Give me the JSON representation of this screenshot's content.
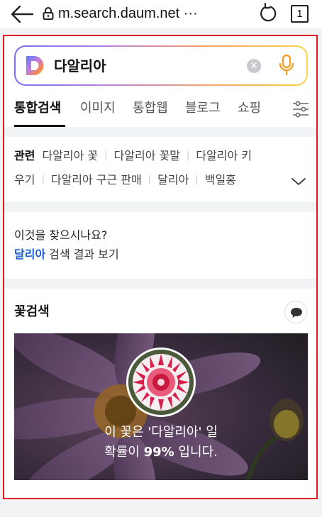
{
  "browser": {
    "url": "m.search.daum.net ···",
    "tab_count": "1"
  },
  "search": {
    "query": "다알리아",
    "tabs": [
      {
        "label": "통합검색"
      },
      {
        "label": "이미지"
      },
      {
        "label": "통합웹"
      },
      {
        "label": "블로그"
      },
      {
        "label": "쇼핑"
      }
    ]
  },
  "related": {
    "label": "관련",
    "line1": [
      "다알리아 꽃",
      "다알리아 꽃말",
      "다알리아 키"
    ],
    "line2": [
      "우기",
      "다알리아 구근 판매",
      "달리아",
      "백일홍"
    ]
  },
  "suggest": {
    "question": "이것을 찾으시나요?",
    "link": "달리아",
    "suffix": " 검색 결과 보기"
  },
  "flower": {
    "title": "꽃검색",
    "result_line1": "이 꽃은 '다알리아' 일",
    "result_prefix": "확률이 ",
    "result_percent": "99%",
    "result_suffix": " 입니다."
  },
  "colors": {
    "accent_frame": "#e21a1f",
    "link": "#1a5fd0",
    "search_gradient": [
      "#7d6df3",
      "#b47fe0",
      "#f2a36b",
      "#f7d24a"
    ]
  }
}
